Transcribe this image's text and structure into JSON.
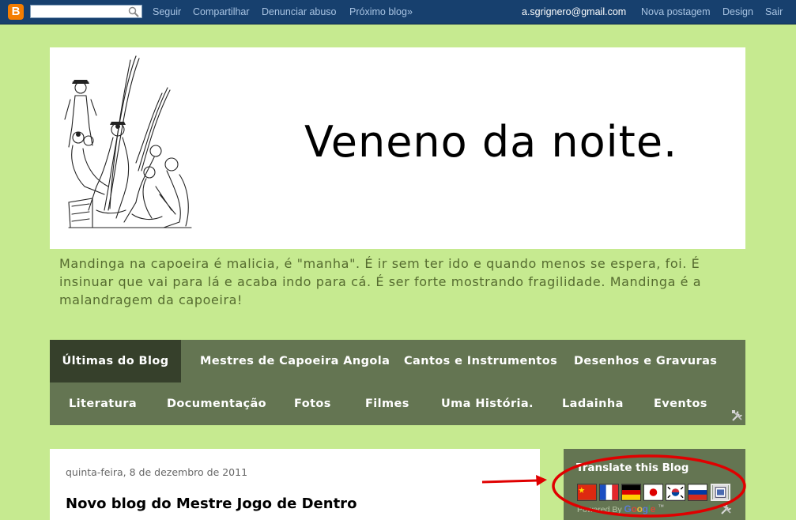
{
  "navbar": {
    "logo_letter": "B",
    "search": {
      "value": "",
      "placeholder": ""
    },
    "links": {
      "follow": "Seguir",
      "share": "Compartilhar",
      "report": "Denunciar abuso",
      "next_blog": "Próximo blog»",
      "email": "a.sgrignero@gmail.com",
      "new_post": "Nova postagem",
      "design": "Design",
      "logout": "Sair"
    }
  },
  "header": {
    "title": "Veneno da noite.",
    "description": "Mandinga na capoeira é malicia, é \"manha\". É ir sem ter ido e quando menos se espera, foi. É insinuar que vai para lá e acaba indo para cá. É ser forte mostrando fragilidade. Mandinga é a malandragem da capoeira!"
  },
  "tabs": {
    "row1": [
      "Últimas do Blog",
      "Mestres de Capoeira Angola",
      "Cantos e Instrumentos",
      "Desenhos e Gravuras"
    ],
    "row2": [
      "Literatura",
      "Documentação",
      "Fotos",
      "Filmes",
      "Uma História.",
      "Ladainha",
      "Eventos"
    ],
    "active_index": 0
  },
  "post": {
    "date": "quinta-feira, 8 de dezembro de 2011",
    "title": "Novo blog do Mestre Jogo de Dentro"
  },
  "sidebar": {
    "translate_title": "Translate this Blog",
    "flags": [
      "china-flag",
      "france-flag",
      "germany-flag",
      "japan-flag",
      "korea-flag",
      "russia-flag",
      "more-languages-icon"
    ],
    "powered_by": "Powered By",
    "google": "Google",
    "trademark": "™"
  },
  "colors": {
    "background": "#c6ea90",
    "navbar": "#17406e",
    "tabs": "#647552",
    "active_tab": "#36402b",
    "annotation": "#e00000"
  }
}
